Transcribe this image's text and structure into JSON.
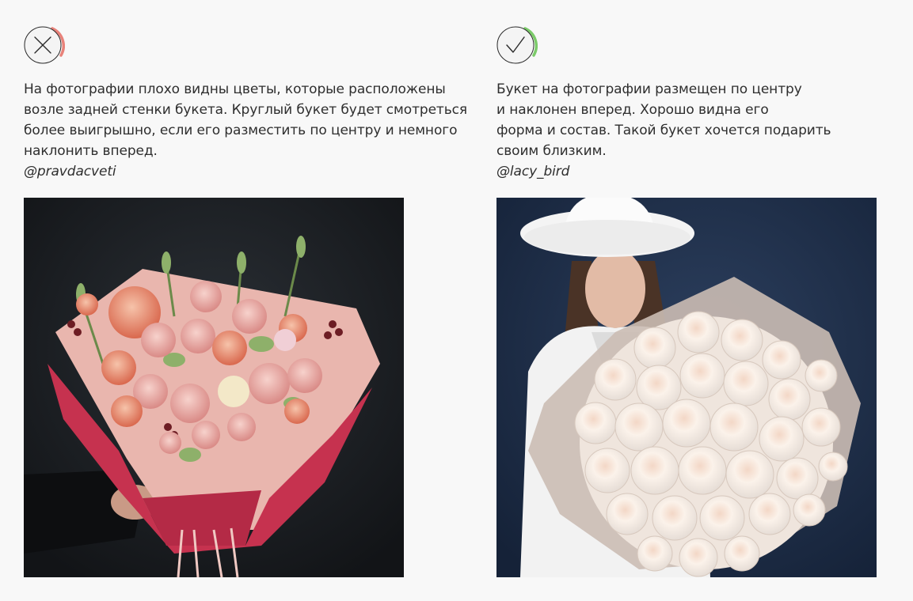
{
  "examples": [
    {
      "verdict": "bad",
      "icon": "cross-icon",
      "accent": "#e8827a",
      "lines": [
        "На фотографии плохо видны цветы, которые расположены",
        "возле задней стенки букета. Круглый букет будет смотреться",
        "более выигрышно, если его разместить по центру и немного",
        "наклонить вперед."
      ],
      "handle": "@pravdacveti"
    },
    {
      "verdict": "good",
      "icon": "check-icon",
      "accent": "#7ccb6a",
      "lines": [
        "Букет на фотографии размещен по центру",
        "и наклонен вперед. Хорошо видна его",
        "форма и состав. Такой букет хочется подарить",
        "своим близким."
      ],
      "handle": "@lacy_bird"
    }
  ]
}
